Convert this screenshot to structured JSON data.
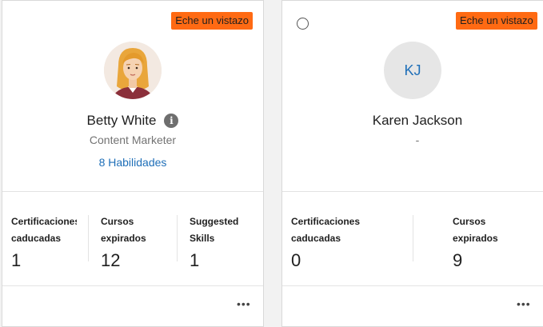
{
  "cards": [
    {
      "badge": "Eche un vistazo",
      "name": "Betty White",
      "role": "Content Marketer",
      "skills_link": "8 Habilidades",
      "stats": [
        {
          "label_line1": "Certificaciones",
          "label_line2": "caducadas",
          "value": "1"
        },
        {
          "label_line1": "Cursos",
          "label_line2": "expirados",
          "value": "12"
        },
        {
          "label_line1": "Suggested",
          "label_line2": "Skills",
          "value": "1"
        }
      ],
      "more_menu": "•••"
    },
    {
      "badge": "Eche un vistazo",
      "initials": "KJ",
      "name": "Karen Jackson",
      "role": "-",
      "stats": [
        {
          "label_line1": "Certificaciones",
          "label_line2": "caducadas",
          "value": "0"
        },
        {
          "label_line1": "Cursos",
          "label_line2": "expirados",
          "value": "9"
        }
      ],
      "more_menu": "•••"
    }
  ],
  "icons": {
    "info": "info-icon",
    "more": "more-options-icon",
    "select": "radio-icon"
  },
  "colors": {
    "badge_bg": "#ff6a13",
    "link": "#1f6fb8",
    "initials_text": "#1f6fb8",
    "avatar_bg": "#e6e6e6"
  }
}
